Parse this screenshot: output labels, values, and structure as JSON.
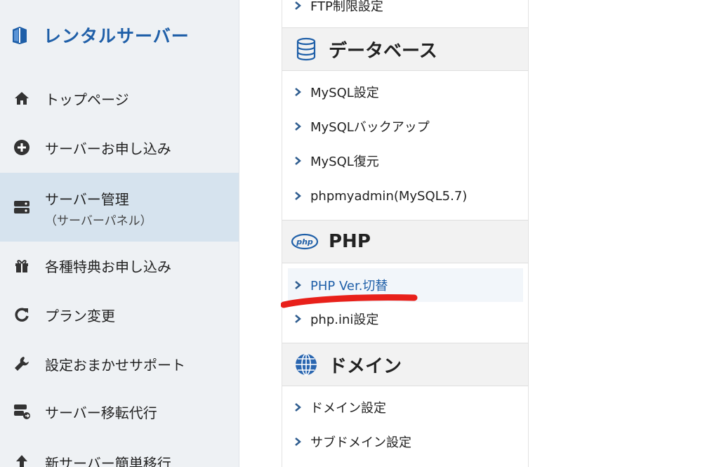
{
  "sidebar": {
    "brand": {
      "title": "レンタルサーバー",
      "icon": "book-icon"
    },
    "items": [
      {
        "label": "トップページ",
        "icon": "home-icon"
      },
      {
        "label": "サーバーお申し込み",
        "icon": "plus-circle-icon"
      },
      {
        "label": "サーバー管理",
        "sub": "（サーバーパネル）",
        "icon": "server-icon",
        "active": true
      },
      {
        "label": "各種特典お申し込み",
        "icon": "gift-icon"
      },
      {
        "label": "プラン変更",
        "icon": "refresh-icon"
      },
      {
        "label": "設定おまかせサポート",
        "icon": "wrench-icon"
      },
      {
        "label": "サーバー移転代行",
        "icon": "server-move-icon"
      },
      {
        "label": "新サーバー簡単移行",
        "icon": "upload-icon"
      }
    ]
  },
  "panel": {
    "top_link": "FTP制限設定",
    "sections": [
      {
        "title": "データベース",
        "icon": "database-icon",
        "links": [
          "MySQL設定",
          "MySQLバックアップ",
          "MySQL復元",
          "phpmyadmin(MySQL5.7)"
        ]
      },
      {
        "title": "PHP",
        "icon": "php-logo-icon",
        "icon_text": "php",
        "links": [
          "PHP Ver.切替",
          "php.ini設定"
        ],
        "active_link": "PHP Ver.切替"
      },
      {
        "title": "ドメイン",
        "icon": "globe-icon",
        "links": [
          "ドメイン設定",
          "サブドメイン設定"
        ]
      }
    ]
  },
  "colors": {
    "accent": "#1f5fa8",
    "annotation": "#e8201a",
    "sidebar_bg": "#eef1f4",
    "active_bg": "#d6e3ee"
  }
}
